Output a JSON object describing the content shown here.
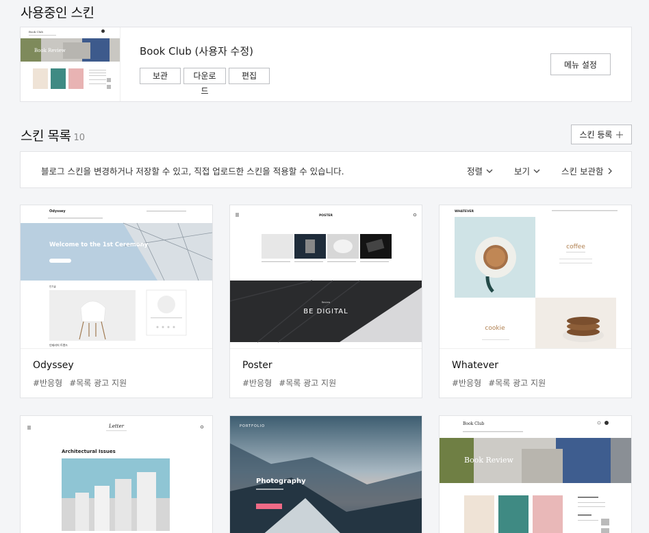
{
  "current": {
    "title": "사용중인 스킨",
    "name": "Book Club (사용자 수정)",
    "buttons": [
      "보관",
      "다운로드",
      "편집"
    ],
    "menu_button": "메뉴 설정",
    "thumb": {
      "brand": "Book Club",
      "banner": "Book Review"
    }
  },
  "list": {
    "title": "스킨 목록",
    "count": "10",
    "register_button": "스킨 등록",
    "notice": "블로그 스킨을 변경하거나 저장할 수 있고, 직접 업로드한 스킨을 적용할 수 있습니다.",
    "sort_label": "정렬",
    "view_label": "보기",
    "archive_label": "스킨 보관함"
  },
  "skins": [
    {
      "name": "Odyssey",
      "tags": [
        "#반응형",
        "#목록 광고 지원"
      ],
      "preview": {
        "brand": "Odyssey",
        "hero": "Welcome to the 1st Ceremony",
        "section": "인테리어 트렌드"
      }
    },
    {
      "name": "Poster",
      "tags": [
        "#반응형",
        "#목록 광고 지원"
      ],
      "preview": {
        "brand": "POSTER",
        "hero": "BE DIGITAL",
        "small": "Review"
      }
    },
    {
      "name": "Whatever",
      "tags": [
        "#반응형",
        "#목록 광고 지원"
      ],
      "preview": {
        "brand": "WHATEVER",
        "word1": "coffee",
        "word2": "cookie"
      }
    },
    {
      "name": "Letter",
      "tags": [],
      "preview": {
        "brand": "Letter",
        "heading": "Architectural Issues"
      }
    },
    {
      "name": "Portfolio",
      "tags": [],
      "preview": {
        "brand": "PORTFOLIO",
        "hero": "Photography"
      }
    },
    {
      "name": "Book Club",
      "tags": [],
      "preview": {
        "brand": "Book Club",
        "banner": "Book Review"
      }
    }
  ],
  "colors": {
    "accent_pink": "#f06a86",
    "border": "#e2e3e6",
    "bg": "#f4f5f7"
  }
}
